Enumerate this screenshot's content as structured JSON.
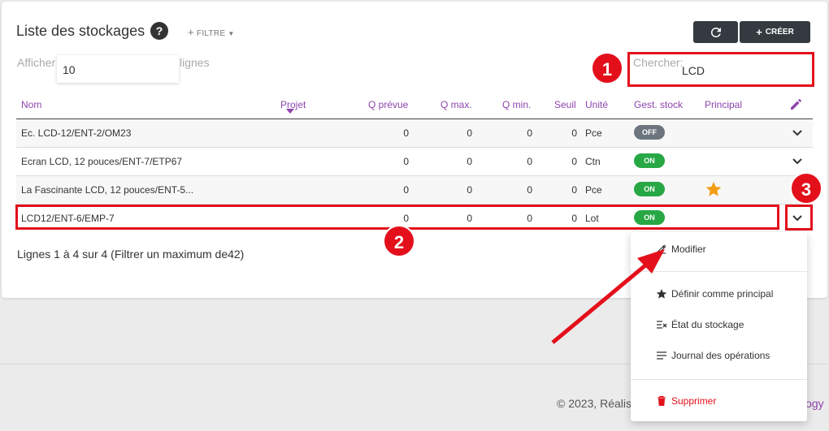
{
  "header": {
    "title": "Liste des stockages",
    "help_glyph": "?",
    "filter_label": "FILTRE",
    "refresh_icon": "refresh-icon",
    "create_label": "CRÉER"
  },
  "controls": {
    "show_prefix": "Afficher",
    "page_size": "10",
    "show_suffix": "lignes",
    "search_label": "Chercher:",
    "search_value": "LCD"
  },
  "table": {
    "columns": [
      "Nom",
      "Projet",
      "Q prévue",
      "Q max.",
      "Q min.",
      "Seuil",
      "Unité",
      "Gest. stock",
      "Principal"
    ],
    "rows": [
      {
        "nom": "Ec. LCD-12/ENT-2/OM23",
        "q_prevue": "0",
        "q_max": "0",
        "q_min": "0",
        "seuil": "0",
        "unite": "Pce",
        "gest": "OFF",
        "principal": false
      },
      {
        "nom": "Ecran LCD, 12 pouces/ENT-7/ETP67",
        "q_prevue": "0",
        "q_max": "0",
        "q_min": "0",
        "seuil": "0",
        "unite": "Ctn",
        "gest": "ON",
        "principal": false
      },
      {
        "nom": "La Fascinante LCD, 12 pouces/ENT-5...",
        "q_prevue": "0",
        "q_max": "0",
        "q_min": "0",
        "seuil": "0",
        "unite": "Pce",
        "gest": "ON",
        "principal": true
      },
      {
        "nom": "LCD12/ENT-6/EMP-7",
        "q_prevue": "0",
        "q_max": "0",
        "q_min": "0",
        "seuil": "0",
        "unite": "Lot",
        "gest": "ON",
        "principal": false
      }
    ],
    "footer": "Lignes 1 à 4 sur 4 (Filtrer un maximum de42)"
  },
  "dropdown": {
    "items": [
      {
        "label": "Modifier",
        "icon": "pencil-icon"
      },
      {
        "label": "Définir comme principal",
        "icon": "star-icon"
      },
      {
        "label": "État du stockage",
        "icon": "list-check-icon"
      },
      {
        "label": "Journal des opérations",
        "icon": "list-icon"
      },
      {
        "label": "Supprimer",
        "icon": "trash-icon"
      }
    ]
  },
  "annotations": {
    "badge_1": "1",
    "badge_2": "2",
    "badge_3": "3"
  },
  "footer": {
    "copyright": "© 2023, Réalis",
    "right_fragment": "logy"
  },
  "colors": {
    "accent_purple": "#8e44ad",
    "annotation_red": "#e3101b",
    "toggle_on": "#28a745",
    "toggle_off": "#6c757d",
    "star": "#f39c12"
  }
}
